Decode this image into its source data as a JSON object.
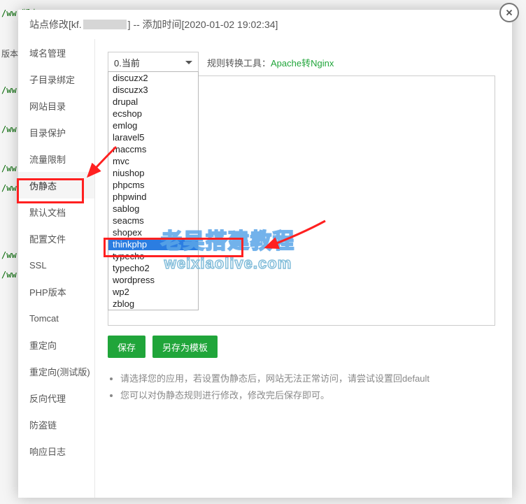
{
  "header": {
    "prefix": "站点修改[kf.",
    "suffix": "] -- 添加时间[2020-01-02 19:02:34]"
  },
  "sidebar": {
    "items": [
      {
        "label": "域名管理"
      },
      {
        "label": "子目录绑定"
      },
      {
        "label": "网站目录"
      },
      {
        "label": "目录保护"
      },
      {
        "label": "流量限制"
      },
      {
        "label": "伪静态"
      },
      {
        "label": "默认文档"
      },
      {
        "label": "配置文件"
      },
      {
        "label": "SSL"
      },
      {
        "label": "PHP版本"
      },
      {
        "label": "Tomcat"
      },
      {
        "label": "重定向"
      },
      {
        "label": "重定向(测试版)"
      },
      {
        "label": "反向代理"
      },
      {
        "label": "防盗链"
      },
      {
        "label": "响应日志"
      }
    ],
    "active_index": 5
  },
  "select": {
    "value": "0.当前",
    "options": [
      "discuzx2",
      "discuzx3",
      "drupal",
      "ecshop",
      "emlog",
      "laravel5",
      "maccms",
      "mvc",
      "niushop",
      "phpcms",
      "phpwind",
      "sablog",
      "seacms",
      "shopex",
      "thinkphp",
      "typecho",
      "typecho2",
      "wordpress",
      "wp2",
      "zblog"
    ],
    "highlight_index": 14
  },
  "convert": {
    "label": "规则转换工具：",
    "link": "Apache转Nginx"
  },
  "buttons": {
    "save": "保存",
    "save_as": "另存为模板"
  },
  "tips": {
    "line1": "请选择您的应用，若设置伪静态后，网站无法正常访问，请尝试设置回default",
    "line2": "您可以对伪静态规则进行修改，修改完后保存即可。"
  },
  "watermark": {
    "top": "老吴搭建教程",
    "bottom": "weixiaolive.com"
  },
  "bg": {
    "l1": "/ww 版本",
    "l2": "版本",
    "l3": "/ww",
    "l4": "/ww",
    "l5": "/ww",
    "l6": "/ww",
    "l7": "/ww",
    "l8": "/ww"
  }
}
